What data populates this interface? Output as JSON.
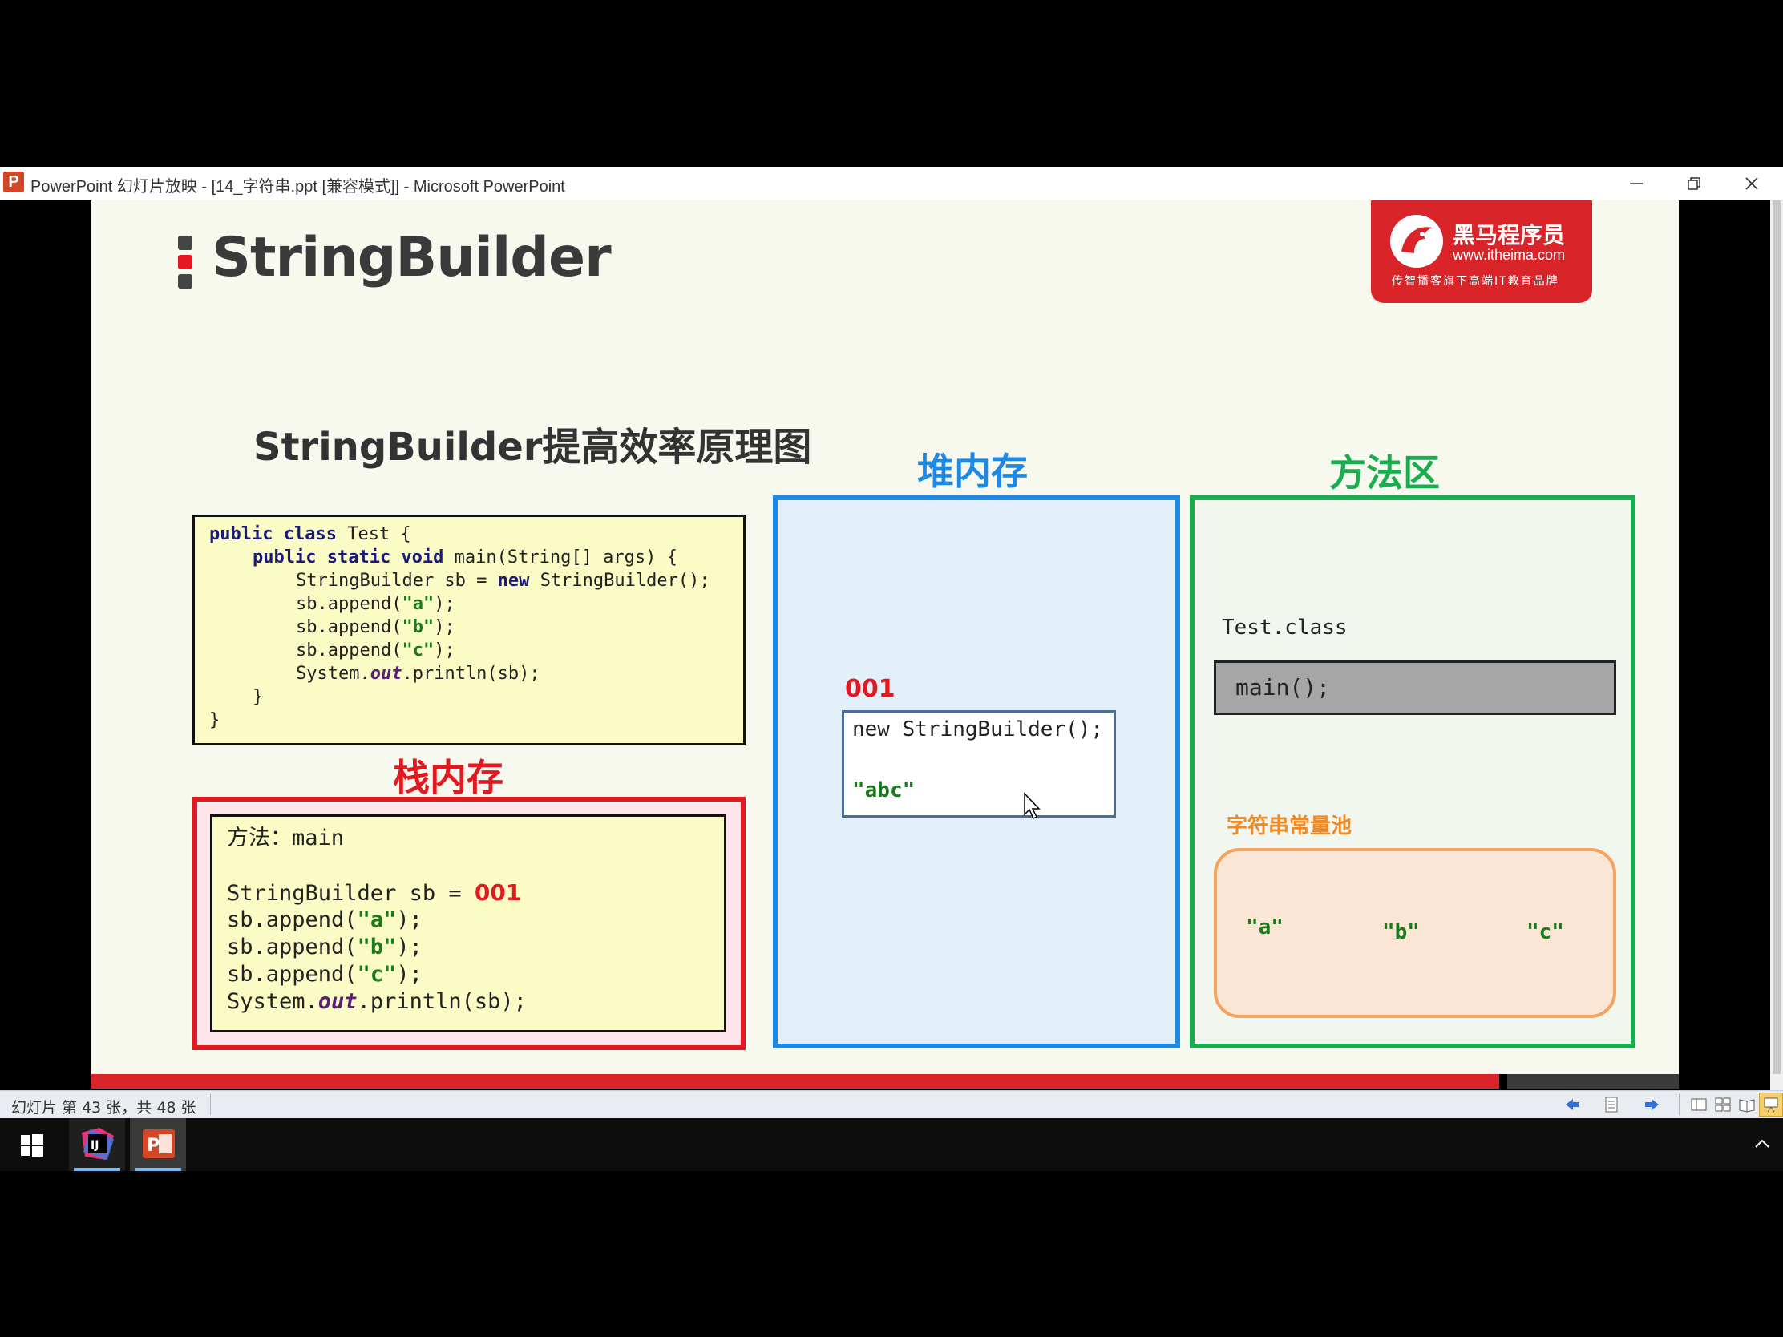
{
  "window": {
    "title": "PowerPoint 幻灯片放映 - [14_字符串.ppt [兼容模式]] - Microsoft PowerPoint",
    "app_icon_letter": "P"
  },
  "slide": {
    "title": "StringBuilder",
    "logo": {
      "name": "黑马程序员",
      "url": "www.itheima.com",
      "slogan": "传智播客旗下高端IT教育品牌"
    },
    "diagram_title": "StringBuilder提高效率原理图",
    "code": {
      "line1_kw": "public class",
      "line1_rest": " Test {",
      "line2_kw": "public static void",
      "line2_rest": " main(String[] args) {",
      "line3_pre": "StringBuilder sb = ",
      "line3_kw": "new",
      "line3_post": " StringBuilder();",
      "append_pre": "sb.append(",
      "a": "\"a\"",
      "b": "\"b\"",
      "c": "\"c\"",
      "append_post": ");",
      "print_pre": "System.",
      "print_out": "out",
      "print_post": ".println(sb);",
      "close_inner": "}",
      "close_outer": "}"
    },
    "stack": {
      "label": "栈内存",
      "method": "方法：main",
      "sb_decl": "StringBuilder sb = ",
      "sb_ref": "001",
      "append_pre": "sb.append(",
      "a": "\"a\"",
      "b": "\"b\"",
      "c": "\"c\"",
      "append_post": ");",
      "print_pre": "System.",
      "print_out": "out",
      "print_post": ".println(sb);"
    },
    "heap": {
      "label": "堆内存",
      "address": "001",
      "object_line": "new StringBuilder();",
      "content": "\"abc\""
    },
    "method_area": {
      "label": "方法区",
      "class_name": "Test.class",
      "method": "main();",
      "pool_label": "字符串常量池",
      "pool_items": [
        "\"a\"",
        "\"b\"",
        "\"c\""
      ]
    }
  },
  "statusbar": {
    "slide_counter": "幻灯片 第 43 张，共 48 张"
  },
  "colors": {
    "stack_red": "#e31820",
    "heap_blue": "#1e88e5",
    "method_green": "#1aad4f",
    "pool_orange": "#f08a24",
    "code_bg": "#fbfbc6",
    "logo_red": "#d9252a"
  }
}
